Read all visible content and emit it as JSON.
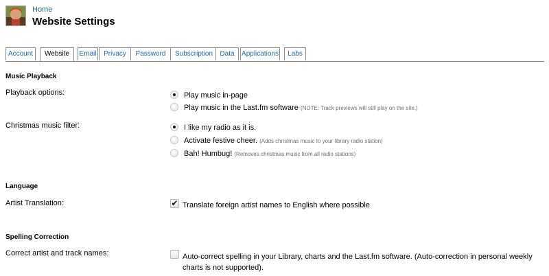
{
  "header": {
    "home_link": "Home",
    "title": "Website Settings"
  },
  "tabs": [
    {
      "label": "Account",
      "active": false
    },
    {
      "label": "Website",
      "active": true
    },
    {
      "label": "Email",
      "active": false
    },
    {
      "label": "Privacy",
      "active": false
    },
    {
      "label": "Password",
      "active": false
    },
    {
      "label": "Subscription",
      "active": false
    },
    {
      "label": "Data",
      "active": false
    },
    {
      "label": "Applications",
      "active": false
    },
    {
      "label": "Labs",
      "active": false
    }
  ],
  "music_playback": {
    "section_title": "Music Playback",
    "playback_options": {
      "label": "Playback options:",
      "options": [
        {
          "text": "Play music in-page",
          "note": "",
          "selected": true
        },
        {
          "text": "Play music in the Last.fm software",
          "note": "(NOTE: Track previews will still play on the site.)",
          "selected": false
        }
      ]
    },
    "christmas_filter": {
      "label": "Christmas music filter:",
      "options": [
        {
          "text": "I like my radio as it is.",
          "note": "",
          "selected": true
        },
        {
          "text": "Activate festive cheer.",
          "note": "(Adds christmas music to your library radio station)",
          "selected": false
        },
        {
          "text": "Bah! Humbug!",
          "note": "(Removes christmas music from all radio stations)",
          "selected": false
        }
      ]
    }
  },
  "language": {
    "section_title": "Language",
    "artist_translation": {
      "label": "Artist Translation:",
      "checkbox_text": "Translate foreign artist names to English where possible",
      "checked": true
    }
  },
  "spelling": {
    "section_title": "Spelling Correction",
    "correct_names": {
      "label": "Correct artist and track names:",
      "checkbox_text": "Auto-correct spelling in your Library, charts and the Last.fm software. (Auto-correction in personal weekly charts is not supported).",
      "checked": false
    }
  },
  "colors": {
    "link": "#2167ad",
    "note": "#6e6e6e",
    "tab_border": "#8a8a8a"
  }
}
